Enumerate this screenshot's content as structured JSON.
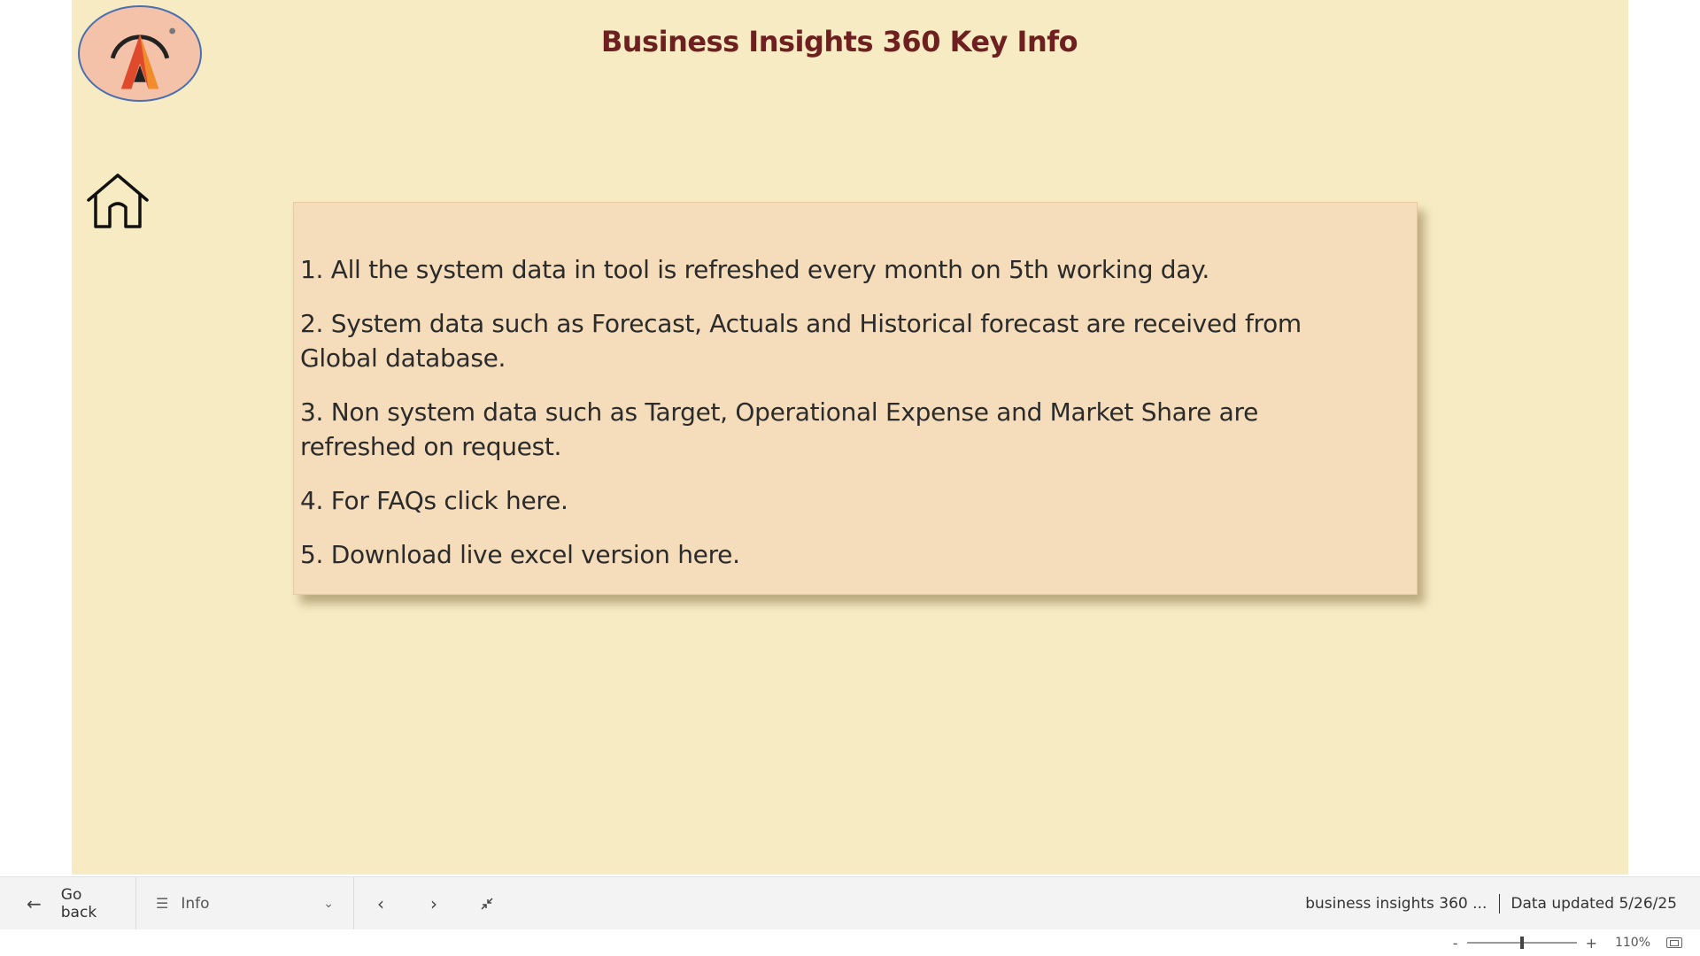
{
  "report": {
    "title": "Business Insights 360 Key Info",
    "background_color": "#f6ebc3",
    "card_color": "#f5dcba",
    "title_color": "#6e1f1f"
  },
  "logo": {
    "icon": "brand-logo-icon"
  },
  "home": {
    "icon": "home-icon"
  },
  "info_items": [
    {
      "text": "1. All the system data in tool is refreshed every month on 5th working day."
    },
    {
      "text": "2.  System data such as Forecast, Actuals and Historical forecast are received from Global database."
    },
    {
      "text": "3.  Non system data such as Target, Operational Expense and Market Share are refreshed on request."
    },
    {
      "text": "4. For FAQs click here."
    },
    {
      "text": "5. Download live excel version here."
    }
  ],
  "bottom_bar": {
    "go_back_label": "Go back",
    "page_selector_label": "Info",
    "report_name": "business insights 360 ...",
    "data_updated": "Data updated 5/26/25"
  },
  "zoom": {
    "minus": "-",
    "plus": "+",
    "level": "110%"
  }
}
